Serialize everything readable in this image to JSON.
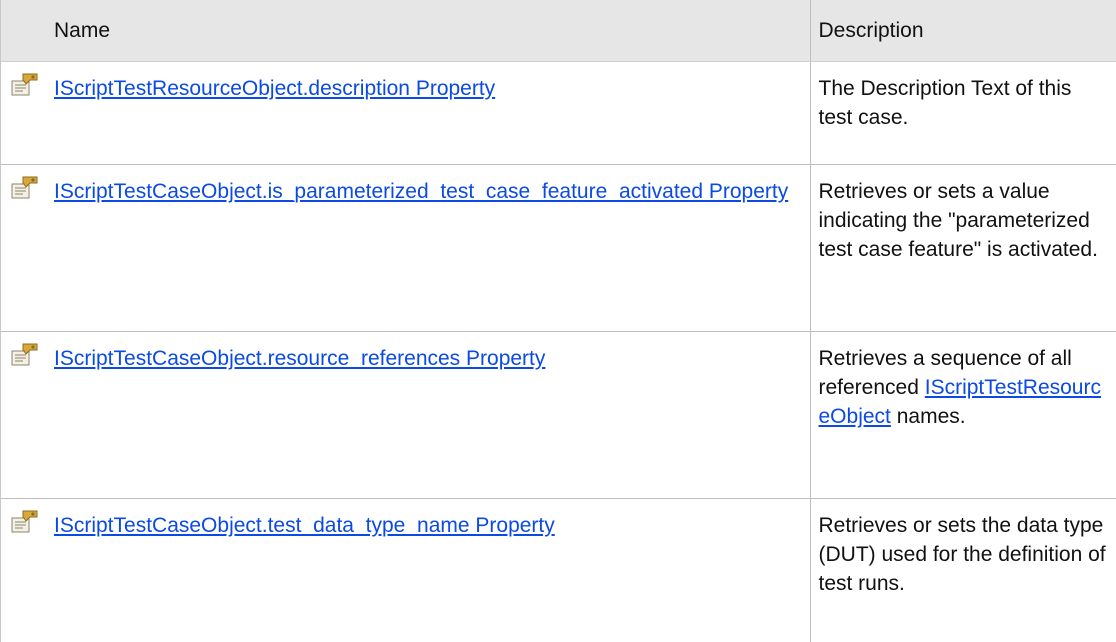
{
  "header": {
    "name_label": "Name",
    "description_label": "Description"
  },
  "rows": [
    {
      "icon": "property-icon",
      "name": "IScriptTestResourceObject.description Property",
      "description": "The Description Text of this test case."
    },
    {
      "icon": "property-icon",
      "name": "IScriptTestCaseObject.is_parameterized_test_case_feature_activated Property",
      "description": "Retrieves or sets a value indicating the \"parameterized test case feature\" is activated."
    },
    {
      "icon": "property-icon",
      "name": "IScriptTestCaseObject.resource_references Property",
      "description_before": "Retrieves a sequence of all referenced",
      "description_link": "IScriptTestResourceObject",
      "description_after": "names."
    },
    {
      "icon": "property-icon",
      "name": "IScriptTestCaseObject.test_data_type_name Property",
      "description": "Retrieves or sets the data type (DUT) used for the definition of test runs."
    }
  ],
  "colors": {
    "header_bg": "#e6e6e6",
    "link": "#0b4ae3",
    "border": "#bdbdbd"
  }
}
